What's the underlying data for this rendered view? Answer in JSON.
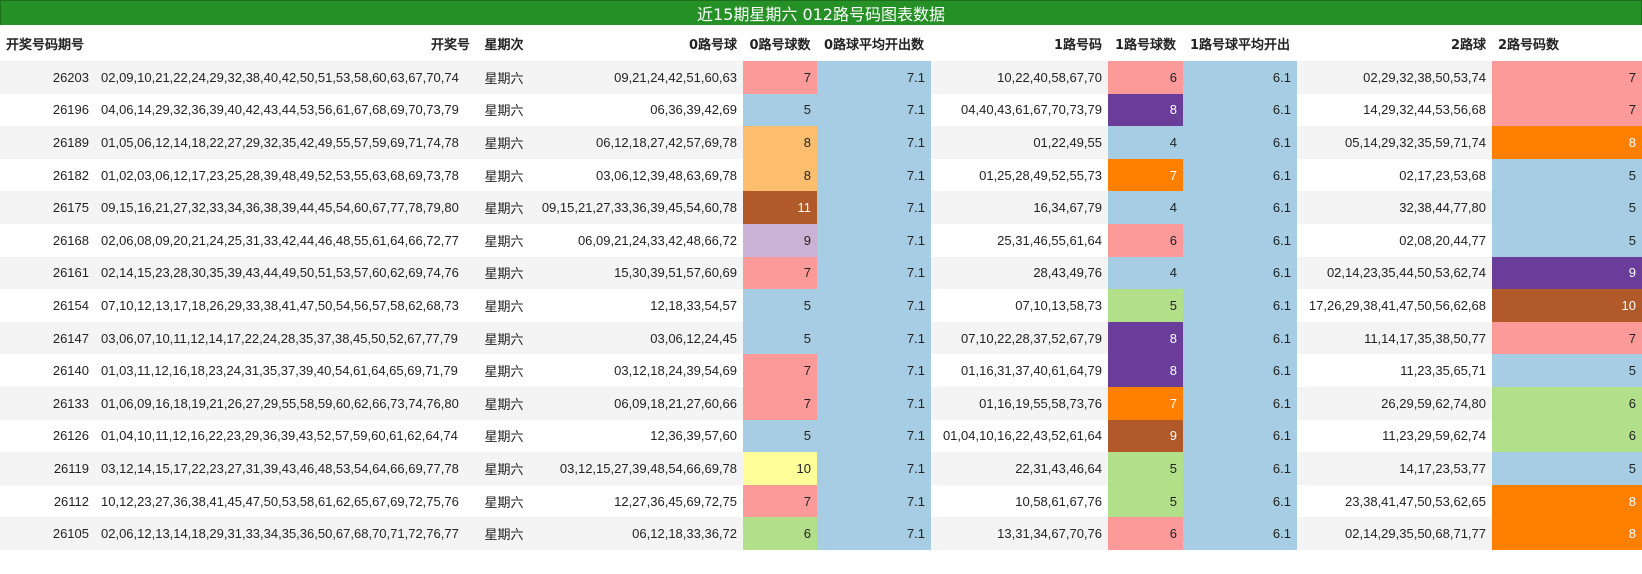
{
  "title": "近15期星期六 012路号码图表数据",
  "columns": [
    "开奖号码期号",
    "开奖号",
    "星期次",
    "0路号球",
    "0路号球数",
    "0路球平均开出数",
    "1路号码",
    "1路号球数",
    "1路号球平均开出",
    "2路球",
    "2路号码数"
  ],
  "heat_colors": {
    "4": "#a6cde3",
    "5": "#a6cde3",
    "6": "#fb9a99",
    "7": "#fb9a99",
    "8": "#fdbf6f",
    "9": "#cab2d6",
    "10": "#ffff99",
    "11": "#b15928",
    "5g": "#b2df8a",
    "6g": "#b2df8a",
    "7o": "#ff7f00",
    "8o": "#ff7f00",
    "8p": "#6a3d9a",
    "9p": "#6a3d9a",
    "9b": "#b15928",
    "10b": "#b15928"
  },
  "rows": [
    {
      "issue": "26203",
      "nums": "02,09,10,21,22,24,29,32,38,40,42,50,51,53,58,60,63,67,70,74",
      "week": "星期六",
      "r0": "09,21,24,42,51,60,63",
      "c0": "7",
      "c0_color": "#fb9a99",
      "avg0": "7.1",
      "r1": "10,22,40,58,67,70",
      "c1": "6",
      "c1_color": "#fb9a99",
      "avg1": "6.1",
      "r2": "02,29,32,38,50,53,74",
      "c2": "7",
      "c2_color": "#fb9a99"
    },
    {
      "issue": "26196",
      "nums": "04,06,14,29,32,36,39,40,42,43,44,53,56,61,67,68,69,70,73,79",
      "week": "星期六",
      "r0": "06,36,39,42,69",
      "c0": "5",
      "c0_color": "#a6cde3",
      "avg0": "7.1",
      "r1": "04,40,43,61,67,70,73,79",
      "c1": "8",
      "c1_color": "#6a3d9a",
      "avg1": "6.1",
      "r2": "14,29,32,44,53,56,68",
      "c2": "7",
      "c2_color": "#fb9a99"
    },
    {
      "issue": "26189",
      "nums": "01,05,06,12,14,18,22,27,29,32,35,42,49,55,57,59,69,71,74,78",
      "week": "星期六",
      "r0": "06,12,18,27,42,57,69,78",
      "c0": "8",
      "c0_color": "#fdbf6f",
      "avg0": "7.1",
      "r1": "01,22,49,55",
      "c1": "4",
      "c1_color": "#a6cde3",
      "avg1": "6.1",
      "r2": "05,14,29,32,35,59,71,74",
      "c2": "8",
      "c2_color": "#ff7f00"
    },
    {
      "issue": "26182",
      "nums": "01,02,03,06,12,17,23,25,28,39,48,49,52,53,55,63,68,69,73,78",
      "week": "星期六",
      "r0": "03,06,12,39,48,63,69,78",
      "c0": "8",
      "c0_color": "#fdbf6f",
      "avg0": "7.1",
      "r1": "01,25,28,49,52,55,73",
      "c1": "7",
      "c1_color": "#ff7f00",
      "avg1": "6.1",
      "r2": "02,17,23,53,68",
      "c2": "5",
      "c2_color": "#a6cde3"
    },
    {
      "issue": "26175",
      "nums": "09,15,16,21,27,32,33,34,36,38,39,44,45,54,60,67,77,78,79,80",
      "week": "星期六",
      "r0": "09,15,21,27,33,36,39,45,54,60,78",
      "c0": "11",
      "c0_color": "#b15928",
      "avg0": "7.1",
      "r1": "16,34,67,79",
      "c1": "4",
      "c1_color": "#a6cde3",
      "avg1": "6.1",
      "r2": "32,38,44,77,80",
      "c2": "5",
      "c2_color": "#a6cde3"
    },
    {
      "issue": "26168",
      "nums": "02,06,08,09,20,21,24,25,31,33,42,44,46,48,55,61,64,66,72,77",
      "week": "星期六",
      "r0": "06,09,21,24,33,42,48,66,72",
      "c0": "9",
      "c0_color": "#cab2d6",
      "avg0": "7.1",
      "r1": "25,31,46,55,61,64",
      "c1": "6",
      "c1_color": "#fb9a99",
      "avg1": "6.1",
      "r2": "02,08,20,44,77",
      "c2": "5",
      "c2_color": "#a6cde3"
    },
    {
      "issue": "26161",
      "nums": "02,14,15,23,28,30,35,39,43,44,49,50,51,53,57,60,62,69,74,76",
      "week": "星期六",
      "r0": "15,30,39,51,57,60,69",
      "c0": "7",
      "c0_color": "#fb9a99",
      "avg0": "7.1",
      "r1": "28,43,49,76",
      "c1": "4",
      "c1_color": "#a6cde3",
      "avg1": "6.1",
      "r2": "02,14,23,35,44,50,53,62,74",
      "c2": "9",
      "c2_color": "#6a3d9a"
    },
    {
      "issue": "26154",
      "nums": "07,10,12,13,17,18,26,29,33,38,41,47,50,54,56,57,58,62,68,73",
      "week": "星期六",
      "r0": "12,18,33,54,57",
      "c0": "5",
      "c0_color": "#a6cde3",
      "avg0": "7.1",
      "r1": "07,10,13,58,73",
      "c1": "5",
      "c1_color": "#b2df8a",
      "avg1": "6.1",
      "r2": "17,26,29,38,41,47,50,56,62,68",
      "c2": "10",
      "c2_color": "#b15928"
    },
    {
      "issue": "26147",
      "nums": "03,06,07,10,11,12,14,17,22,24,28,35,37,38,45,50,52,67,77,79",
      "week": "星期六",
      "r0": "03,06,12,24,45",
      "c0": "5",
      "c0_color": "#a6cde3",
      "avg0": "7.1",
      "r1": "07,10,22,28,37,52,67,79",
      "c1": "8",
      "c1_color": "#6a3d9a",
      "avg1": "6.1",
      "r2": "11,14,17,35,38,50,77",
      "c2": "7",
      "c2_color": "#fb9a99"
    },
    {
      "issue": "26140",
      "nums": "01,03,11,12,16,18,23,24,31,35,37,39,40,54,61,64,65,69,71,79",
      "week": "星期六",
      "r0": "03,12,18,24,39,54,69",
      "c0": "7",
      "c0_color": "#fb9a99",
      "avg0": "7.1",
      "r1": "01,16,31,37,40,61,64,79",
      "c1": "8",
      "c1_color": "#6a3d9a",
      "avg1": "6.1",
      "r2": "11,23,35,65,71",
      "c2": "5",
      "c2_color": "#a6cde3"
    },
    {
      "issue": "26133",
      "nums": "01,06,09,16,18,19,21,26,27,29,55,58,59,60,62,66,73,74,76,80",
      "week": "星期六",
      "r0": "06,09,18,21,27,60,66",
      "c0": "7",
      "c0_color": "#fb9a99",
      "avg0": "7.1",
      "r1": "01,16,19,55,58,73,76",
      "c1": "7",
      "c1_color": "#ff7f00",
      "avg1": "6.1",
      "r2": "26,29,59,62,74,80",
      "c2": "6",
      "c2_color": "#b2df8a"
    },
    {
      "issue": "26126",
      "nums": "01,04,10,11,12,16,22,23,29,36,39,43,52,57,59,60,61,62,64,74",
      "week": "星期六",
      "r0": "12,36,39,57,60",
      "c0": "5",
      "c0_color": "#a6cde3",
      "avg0": "7.1",
      "r1": "01,04,10,16,22,43,52,61,64",
      "c1": "9",
      "c1_color": "#b15928",
      "avg1": "6.1",
      "r2": "11,23,29,59,62,74",
      "c2": "6",
      "c2_color": "#b2df8a"
    },
    {
      "issue": "26119",
      "nums": "03,12,14,15,17,22,23,27,31,39,43,46,48,53,54,64,66,69,77,78",
      "week": "星期六",
      "r0": "03,12,15,27,39,48,54,66,69,78",
      "c0": "10",
      "c0_color": "#ffff99",
      "avg0": "7.1",
      "r1": "22,31,43,46,64",
      "c1": "5",
      "c1_color": "#b2df8a",
      "avg1": "6.1",
      "r2": "14,17,23,53,77",
      "c2": "5",
      "c2_color": "#a6cde3"
    },
    {
      "issue": "26112",
      "nums": "10,12,23,27,36,38,41,45,47,50,53,58,61,62,65,67,69,72,75,76",
      "week": "星期六",
      "r0": "12,27,36,45,69,72,75",
      "c0": "7",
      "c0_color": "#fb9a99",
      "avg0": "7.1",
      "r1": "10,58,61,67,76",
      "c1": "5",
      "c1_color": "#b2df8a",
      "avg1": "6.1",
      "r2": "23,38,41,47,50,53,62,65",
      "c2": "8",
      "c2_color": "#ff7f00"
    },
    {
      "issue": "26105",
      "nums": "02,06,12,13,14,18,29,31,33,34,35,36,50,67,68,70,71,72,76,77",
      "week": "星期六",
      "r0": "06,12,18,33,36,72",
      "c0": "6",
      "c0_color": "#b2df8a",
      "avg0": "7.1",
      "r1": "13,31,34,67,70,76",
      "c1": "6",
      "c1_color": "#fb9a99",
      "avg1": "6.1",
      "r2": "02,14,29,35,50,68,71,77",
      "c2": "8",
      "c2_color": "#ff7f00"
    }
  ]
}
